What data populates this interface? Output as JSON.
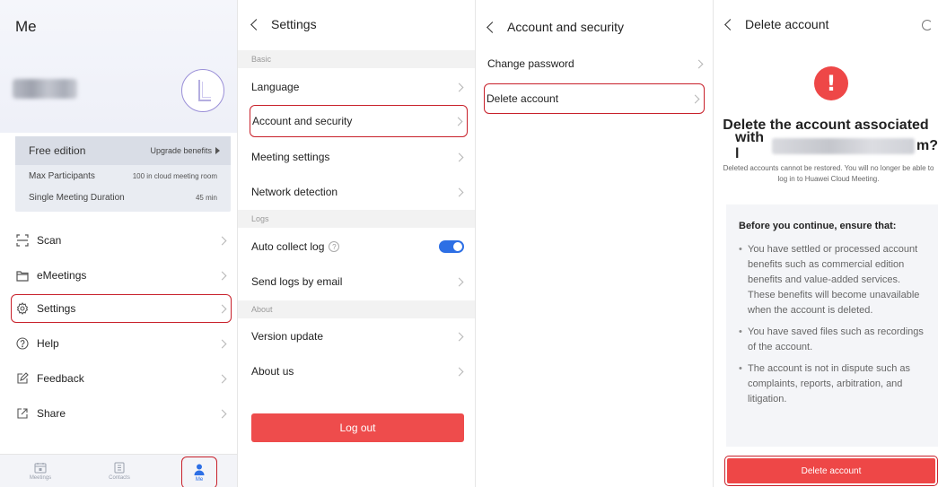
{
  "colors": {
    "accent": "#2d6fe5",
    "danger": "#ee4747",
    "highlight": "#c8202a"
  },
  "me": {
    "title": "Me",
    "edition": {
      "name": "Free edition",
      "upgrade": "Upgrade benefits",
      "rows": [
        {
          "label": "Max Participants",
          "value": "100 in cloud meeting room"
        },
        {
          "label": "Single Meeting Duration",
          "value": "45 min"
        }
      ]
    },
    "menu": [
      {
        "label": "Scan",
        "icon": "scan-icon"
      },
      {
        "label": "eMeetings",
        "icon": "folder-icon"
      },
      {
        "label": "Settings",
        "icon": "gear-icon"
      },
      {
        "label": "Help",
        "icon": "help-icon"
      },
      {
        "label": "Feedback",
        "icon": "feedback-icon"
      },
      {
        "label": "Share",
        "icon": "share-icon"
      }
    ],
    "tabs": [
      {
        "label": "Meetings",
        "icon": "calendar-icon"
      },
      {
        "label": "Contacts",
        "icon": "contacts-icon"
      },
      {
        "label": "Me",
        "icon": "person-icon"
      }
    ]
  },
  "settings": {
    "title": "Settings",
    "sections": {
      "basic": "Basic",
      "logs": "Logs",
      "about": "About"
    },
    "items": {
      "language": "Language",
      "account_security": "Account and security",
      "meeting_settings": "Meeting settings",
      "network_detection": "Network detection",
      "auto_collect": "Auto collect log",
      "send_logs": "Send logs by email",
      "version_update": "Version update",
      "about_us": "About us"
    },
    "auto_collect_on": true,
    "logout": "Log out"
  },
  "account": {
    "title": "Account and security",
    "items": {
      "change_password": "Change password",
      "delete_account": "Delete account"
    }
  },
  "delete": {
    "title": "Delete account",
    "heading_line1": "Delete the account associated",
    "heading_prefix": "with l",
    "heading_suffix": "m?",
    "subtitle": "Deleted accounts cannot be restored. You will no longer be able to log in to Huawei Cloud Meeting.",
    "ensure_title": "Before you continue, ensure that:",
    "ensure_items": [
      "You have settled or processed account benefits such as commercial edition benefits and value-added services. These benefits will become unavailable when the account is deleted.",
      "You have saved files such as recordings of the account.",
      "The account is not in dispute such as complaints, reports, arbitration, and litigation."
    ],
    "button": "Delete account"
  }
}
